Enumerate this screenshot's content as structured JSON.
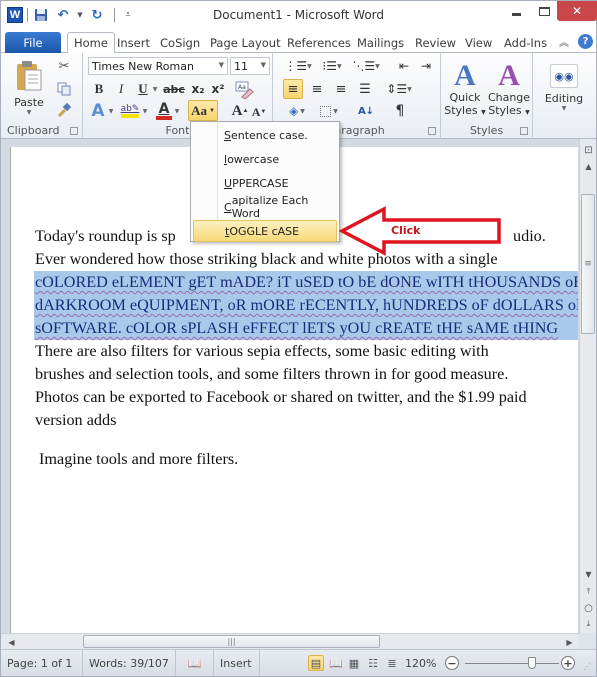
{
  "window": {
    "title": "Document1  -  Microsoft Word",
    "app_icon": "word-logo-icon",
    "controls": [
      "minimize",
      "maximize",
      "close"
    ]
  },
  "quick_access": [
    {
      "name": "save-icon",
      "glyph": "💾"
    },
    {
      "name": "undo-icon",
      "glyph": "↶"
    },
    {
      "name": "redo-icon",
      "glyph": "↻"
    },
    {
      "name": "customize-qat-icon",
      "glyph": "⩡"
    }
  ],
  "tabs": [
    {
      "label": "File"
    },
    {
      "label": "Home",
      "active": true
    },
    {
      "label": "Insert"
    },
    {
      "label": "CoSign"
    },
    {
      "label": "Page Layout"
    },
    {
      "label": "References"
    },
    {
      "label": "Mailings"
    },
    {
      "label": "Review"
    },
    {
      "label": "View"
    },
    {
      "label": "Add-Ins"
    }
  ],
  "ribbon": {
    "clipboard": {
      "label": "Clipboard",
      "paste_label": "Paste"
    },
    "font": {
      "label": "Font",
      "font_name": "Times New Roman",
      "font_size": "11",
      "bold": "B",
      "italic": "I",
      "underline": "U",
      "strikethrough": "abc",
      "subscript": "x₂",
      "superscript": "x²",
      "change_case": "Aa",
      "grow_font": "A",
      "shrink_font": "A",
      "highlight_color": "#f5e400",
      "font_color": "#d42a1e"
    },
    "paragraph": {
      "label": "Paragraph"
    },
    "styles": {
      "label": "Styles",
      "quick_styles": "Quick Styles",
      "quick_styles_line1": "Quick",
      "quick_styles_line2": "Styles",
      "change_styles_line1": "Change",
      "change_styles_line2": "Styles"
    },
    "editing": {
      "label": "Editing"
    }
  },
  "change_case_menu": {
    "items": [
      {
        "underline": "S",
        "rest": "entence case."
      },
      {
        "underline": "l",
        "rest": "owercase"
      },
      {
        "underline": "U",
        "rest": "PPERCASE"
      },
      {
        "underline": "C",
        "rest": "apitalize Each Word"
      },
      {
        "underline": "t",
        "rest": "OGGLE cASE",
        "highlighted": true
      }
    ]
  },
  "annotation": {
    "label": "Click",
    "color": "#e0141e"
  },
  "document": {
    "lines": [
      {
        "text": "Today's roundup is sp",
        "tail": "udio.",
        "selected": false
      },
      {
        "text": "Ever wondered how those striking black and white photos with a single",
        "selected": false
      },
      {
        "text": "cOLORED eLEMENT gET mADE? iT uSED tO bE dONE wITH tHOUSANDS oF",
        "selected": true
      },
      {
        "text": "dARKROOM eQUIPMENT, oR mORE rECENTLY, hUNDREDS oF dOLLARS oF",
        "selected": true
      },
      {
        "text": "sOFTWARE. cOLOR sPLASH eFFECT lETS yOU cREATE tHE sAME tHING",
        "selected": true
      },
      {
        "text": "There are also filters for various sepia effects, some basic editing with",
        "selected": false
      },
      {
        "text": "brushes and selection tools, and some filters thrown in for good measure.",
        "selected": false
      },
      {
        "text": "Photos can be exported to Facebook or shared on twitter, and the $1.99 paid",
        "selected": false
      },
      {
        "text": "version adds",
        "selected": false
      }
    ],
    "last_paragraph": " Imagine tools and more filters.",
    "selection_color": "#a9c8ea"
  },
  "status_bar": {
    "page": "Page: 1 of 1",
    "words": "Words: 39/107",
    "mode": "Insert",
    "zoom": "120%",
    "zoom_level_percent": 120
  }
}
